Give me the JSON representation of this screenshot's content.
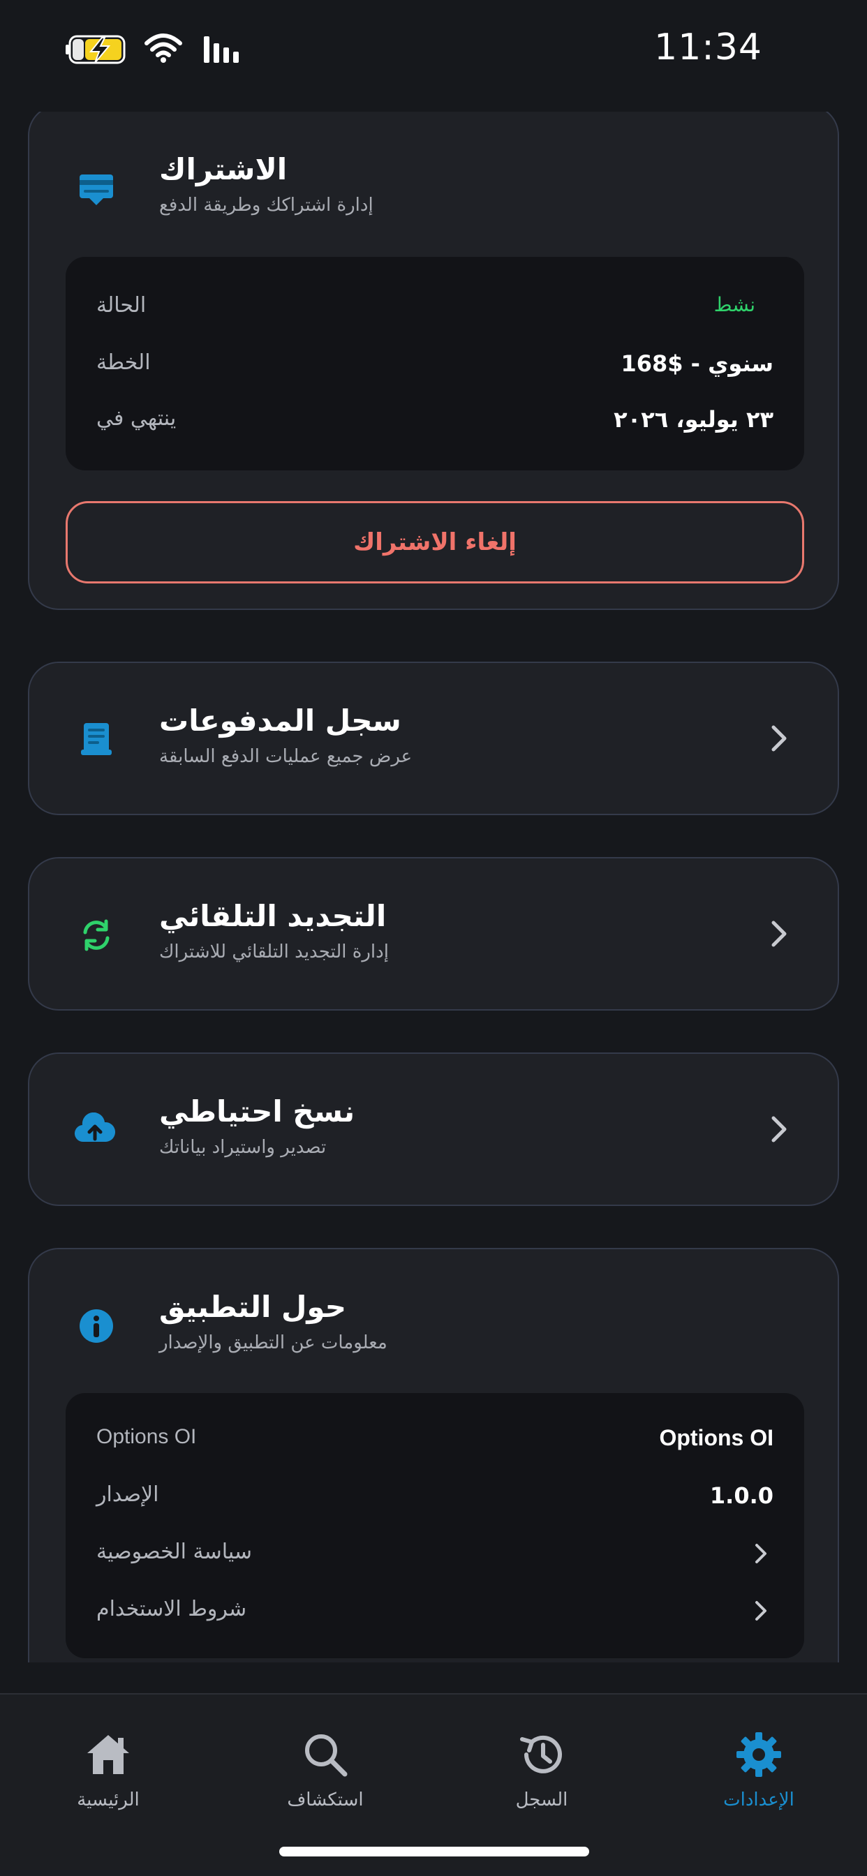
{
  "status_bar": {
    "time": "11:34"
  },
  "subscription": {
    "title": "الاشتراك",
    "subtitle": "إدارة اشتراكك وطريقة الدفع",
    "rows": [
      {
        "label": "الحالة",
        "value": "نشط"
      },
      {
        "label": "الخطة",
        "value": "سنوي - $168"
      },
      {
        "label": "ينتهي في",
        "value": "٢٣ يوليو، ٢٠٢٦"
      }
    ],
    "cancel_label": "إلغاء الاشتراك",
    "colors": {
      "status_active": "#2fd26b",
      "cancel": "#f0736a"
    }
  },
  "payment_history": {
    "title": "سجل المدفوعات",
    "subtitle": "عرض جميع عمليات الدفع السابقة"
  },
  "auto_renewal": {
    "title": "التجديد التلقائي",
    "subtitle": "إدارة التجديد التلقائي للاشتراك"
  },
  "backup": {
    "title": "نسخ احتياطي",
    "subtitle": "تصدير واستيراد بياناتك"
  },
  "about": {
    "title": "حول التطبيق",
    "subtitle": "معلومات عن التطبيق والإصدار",
    "rows": [
      {
        "label": "Options OI",
        "value": "Options OI"
      },
      {
        "label": "الإصدار",
        "value": "1.0.0"
      },
      {
        "label": "سياسة الخصوصية"
      },
      {
        "label": "شروط الاستخدام"
      }
    ]
  },
  "bottom_nav": {
    "items": [
      {
        "label": "الرئيسية",
        "icon": "home-icon"
      },
      {
        "label": "استكشاف",
        "icon": "search-icon"
      },
      {
        "label": "السجل",
        "icon": "history-icon"
      },
      {
        "label": "الإعدادات",
        "icon": "gear-icon",
        "active": true
      }
    ],
    "active_color": "#1a8fd0"
  },
  "accent_color": "#1a8fd0"
}
